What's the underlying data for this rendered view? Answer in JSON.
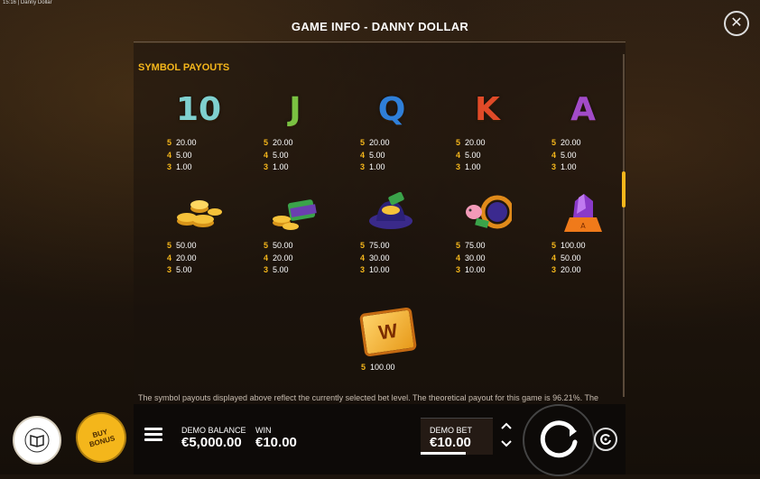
{
  "status_bar": {
    "time": "15:16",
    "app": "Danny Dollar"
  },
  "header": {
    "title": "GAME INFO - DANNY DOLLAR"
  },
  "section": {
    "title": "SYMBOL PAYOUTS"
  },
  "symbols": [
    {
      "name": "10",
      "color": "#7fd0cf",
      "payouts": [
        [
          "5",
          "20.00"
        ],
        [
          "4",
          "5.00"
        ],
        [
          "3",
          "1.00"
        ]
      ]
    },
    {
      "name": "J",
      "color": "#7ac142",
      "payouts": [
        [
          "5",
          "20.00"
        ],
        [
          "4",
          "5.00"
        ],
        [
          "3",
          "1.00"
        ]
      ]
    },
    {
      "name": "Q",
      "color": "#2f7fd8",
      "payouts": [
        [
          "5",
          "20.00"
        ],
        [
          "4",
          "5.00"
        ],
        [
          "3",
          "1.00"
        ]
      ]
    },
    {
      "name": "K",
      "color": "#e04a28",
      "payouts": [
        [
          "5",
          "20.00"
        ],
        [
          "4",
          "5.00"
        ],
        [
          "3",
          "1.00"
        ]
      ]
    },
    {
      "name": "A",
      "color": "#a24bc8",
      "payouts": [
        [
          "5",
          "20.00"
        ],
        [
          "4",
          "5.00"
        ],
        [
          "3",
          "1.00"
        ]
      ]
    },
    {
      "name": "coins-icon",
      "payouts": [
        [
          "5",
          "50.00"
        ],
        [
          "4",
          "20.00"
        ],
        [
          "3",
          "5.00"
        ]
      ]
    },
    {
      "name": "cash-stack-icon",
      "payouts": [
        [
          "5",
          "50.00"
        ],
        [
          "4",
          "20.00"
        ],
        [
          "3",
          "5.00"
        ]
      ]
    },
    {
      "name": "hat-icon",
      "payouts": [
        [
          "5",
          "75.00"
        ],
        [
          "4",
          "30.00"
        ],
        [
          "3",
          "10.00"
        ]
      ]
    },
    {
      "name": "pig-icon",
      "payouts": [
        [
          "5",
          "75.00"
        ],
        [
          "4",
          "30.00"
        ],
        [
          "3",
          "10.00"
        ]
      ]
    },
    {
      "name": "gem-icon",
      "payouts": [
        [
          "5",
          "100.00"
        ],
        [
          "4",
          "50.00"
        ],
        [
          "3",
          "20.00"
        ]
      ]
    },
    {
      "name": "wild-icon",
      "label": "W",
      "payouts": [
        [
          "5",
          "100.00"
        ]
      ]
    }
  ],
  "info_text": "The symbol payouts displayed above reflect the currently selected bet level. The theoretical payout for this game is 96.21%. The",
  "bottom": {
    "demo_balance_label": "DEMO BALANCE",
    "demo_balance_value": "€5,000.00",
    "win_label": "WIN",
    "win_value": "€10.00",
    "demo_bet_label": "DEMO BET",
    "demo_bet_value": "€10.00"
  },
  "buy_bonus": {
    "label1": "BUY",
    "label2": "BONUS"
  },
  "book_button": {
    "label": "BOOK OF BONUS"
  },
  "close_label": "✕"
}
